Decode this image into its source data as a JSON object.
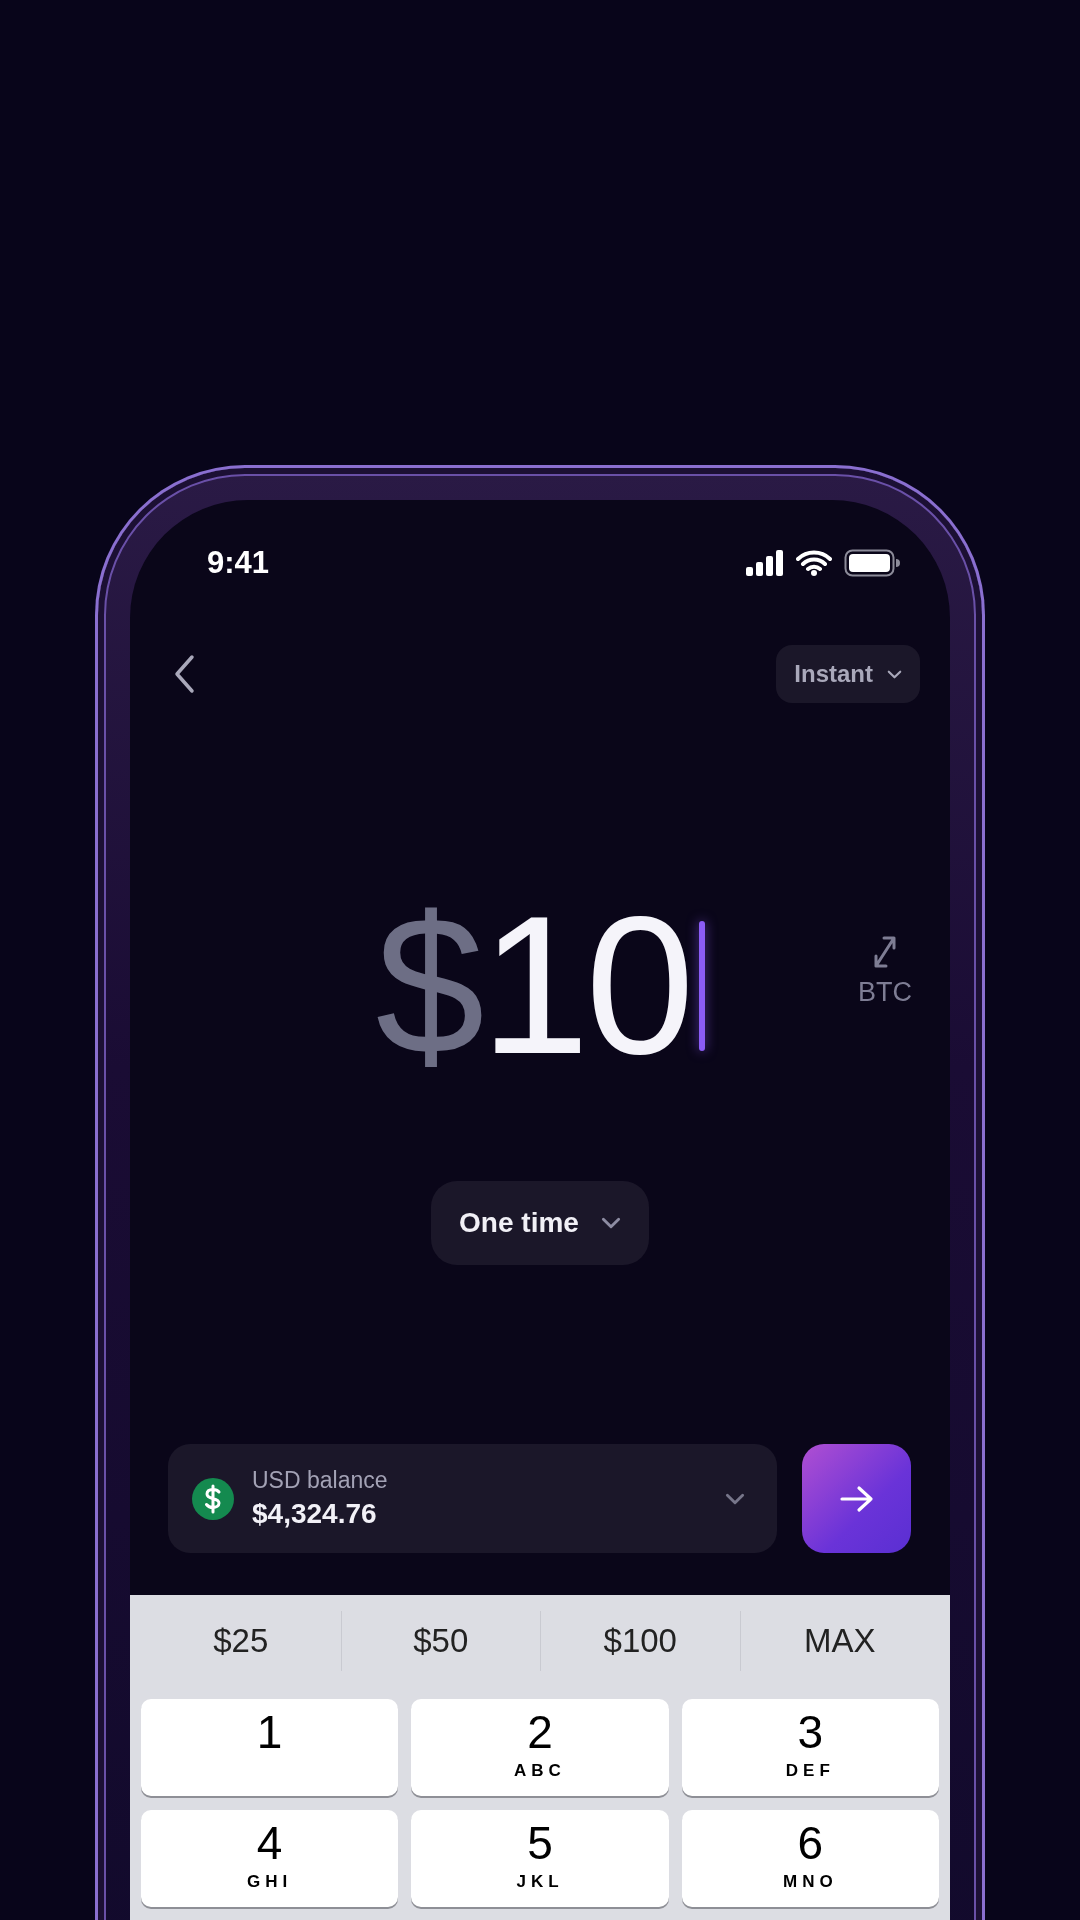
{
  "status_bar": {
    "time": "9:41"
  },
  "header": {
    "speed_selector": {
      "label": "Instant"
    }
  },
  "amount": {
    "currency_symbol": "$",
    "value": "10"
  },
  "currency_toggle": {
    "label": "BTC"
  },
  "frequency_selector": {
    "label": "One time"
  },
  "funding_source": {
    "label": "USD balance",
    "balance": "$4,324.76"
  },
  "quick_amounts": [
    "$25",
    "$50",
    "$100",
    "MAX"
  ],
  "keypad": [
    {
      "digit": "1"
    },
    {
      "digit": "2",
      "letters": "ABC"
    },
    {
      "digit": "3",
      "letters": "DEF"
    },
    {
      "digit": "4",
      "letters": "GHI"
    },
    {
      "digit": "5",
      "letters": "JKL"
    },
    {
      "digit": "6",
      "letters": "MNO"
    }
  ]
}
